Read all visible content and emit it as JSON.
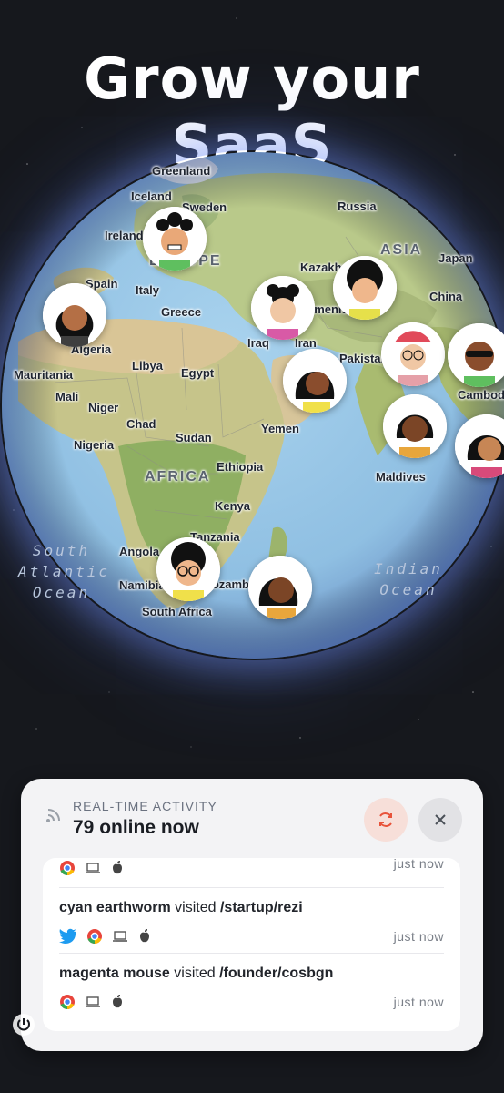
{
  "headline": "Grow your SaaS",
  "map": {
    "labels": {
      "greenland": "Greenland",
      "iceland": "Iceland",
      "sweden": "Sweden",
      "russia": "Russia",
      "ireland": "Ireland",
      "europe": "EUROPE",
      "asia": "ASIA",
      "japan": "Japan",
      "spain": "Spain",
      "italy": "Italy",
      "kazakhstan": "Kazakhstan",
      "china": "China",
      "greece": "Greece",
      "turkmenistan": "Turkmenistan",
      "algeria": "Algeria",
      "iraq": "Iraq",
      "iran": "Iran",
      "pakistan": "Pakistan",
      "mauritania": "Mauritania",
      "libya": "Libya",
      "egypt": "Egypt",
      "cambodia": "Cambodia",
      "mali": "Mali",
      "niger": "Niger",
      "chad": "Chad",
      "yemen": "Yemen",
      "sudan": "Sudan",
      "nigeria": "Nigeria",
      "maldives": "Maldives",
      "africa": "AFRICA",
      "ethiopia": "Ethiopia",
      "kenya": "Kenya",
      "tanzania": "Tanzania",
      "angola": "Angola",
      "namibia": "Namibia",
      "mozambique": "Mozambique",
      "south_africa": "South Africa",
      "south_atlantic_ocean": "South Atlantic Ocean",
      "indian_ocean": "Indian Ocean"
    }
  },
  "panel": {
    "caption": "REAL-TIME ACTIVITY",
    "title": "79 online now",
    "rows": [
      {
        "time": "just now"
      },
      {
        "name": "cyan earthworm",
        "verb": " visited ",
        "path": "/startup/rezi",
        "time": "just now",
        "icons": [
          "twitter-icon",
          "chrome-icon",
          "laptop-icon",
          "apple-icon"
        ]
      },
      {
        "name": "magenta mouse",
        "verb": " visited ",
        "path": "/founder/cosbgn",
        "time": "just now",
        "icons": [
          "chrome-icon",
          "laptop-icon",
          "apple-icon"
        ]
      }
    ]
  },
  "colors": {
    "background": "#16181d",
    "panel": "#f3f3f5",
    "accent_refresh": "#e8533a",
    "twitter": "#1d9bf0"
  }
}
